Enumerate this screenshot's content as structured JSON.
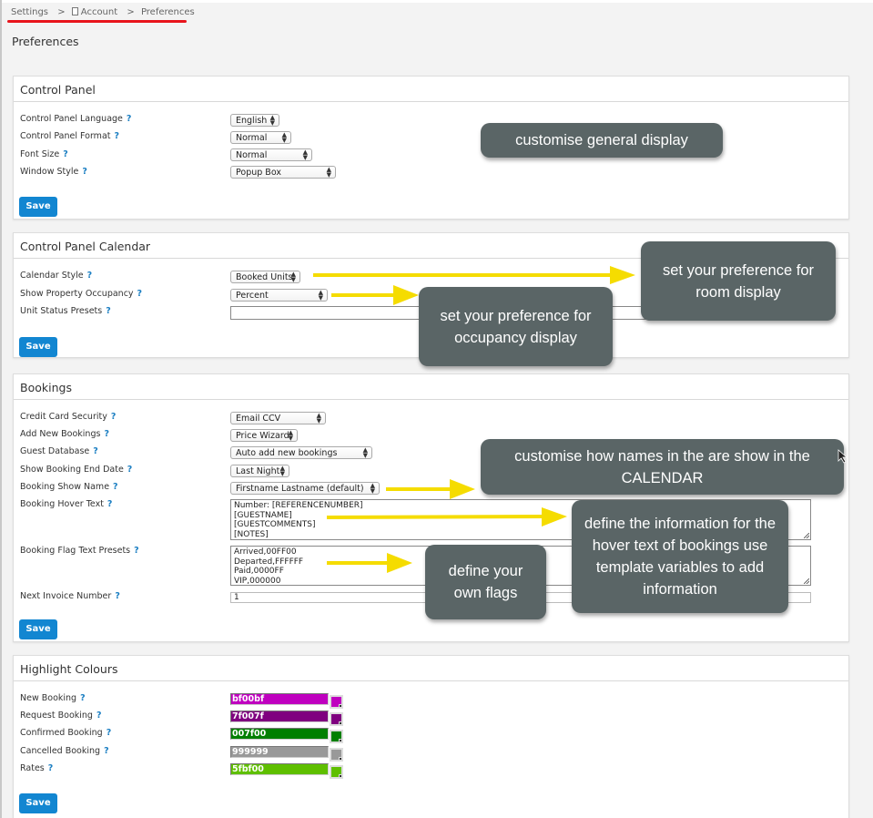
{
  "breadcrumb": {
    "items": [
      "Settings",
      "Account",
      "Preferences"
    ],
    "separator": ">"
  },
  "page_title": "Preferences",
  "help_glyph": "?",
  "save_label": "Save",
  "control_panel": {
    "title": "Control Panel",
    "fields": [
      {
        "label": "Control Panel Language",
        "value": "English"
      },
      {
        "label": "Control Panel Format",
        "value": "Normal"
      },
      {
        "label": "Font Size",
        "value": "Normal"
      },
      {
        "label": "Window Style",
        "value": "Popup Box"
      }
    ]
  },
  "calendar": {
    "title": "Control Panel Calendar",
    "fields": [
      {
        "label": "Calendar Style",
        "value": "Booked Units"
      },
      {
        "label": "Show Property Occupancy",
        "value": "Percent"
      },
      {
        "label": "Unit Status Presets",
        "value": ""
      }
    ]
  },
  "bookings": {
    "title": "Bookings",
    "fields": [
      {
        "label": "Credit Card Security",
        "value": "Email CCV"
      },
      {
        "label": "Add New Bookings",
        "value": "Price Wizard"
      },
      {
        "label": "Guest Database",
        "value": "Auto add new bookings"
      },
      {
        "label": "Show Booking End Date",
        "value": "Last Night"
      },
      {
        "label": "Booking Show Name",
        "value": "Firstname Lastname (default)"
      },
      {
        "label": "Booking Hover Text",
        "value": "Number: [REFERENCENUMBER]\n[GUESTNAME]\n[GUESTCOMMENTS]\n[NOTES]"
      },
      {
        "label": "Booking Flag Text Presets",
        "value": "Arrived,00FF00\nDeparted,FFFFFF\nPaid,0000FF\nVIP,000000"
      },
      {
        "label": "Next Invoice Number",
        "value": "1"
      }
    ]
  },
  "highlight_colours": {
    "title": "Highlight Colours",
    "fields": [
      {
        "label": "New Booking",
        "value": "bf00bf",
        "color": "#bf00bf"
      },
      {
        "label": "Request Booking",
        "value": "7f007f",
        "color": "#7f007f"
      },
      {
        "label": "Confirmed Booking",
        "value": "007f00",
        "color": "#007f00"
      },
      {
        "label": "Cancelled Booking",
        "value": "999999",
        "color": "#999999"
      },
      {
        "label": "Rates",
        "value": "5fbf00",
        "color": "#5fbf00"
      }
    ]
  },
  "annotations": {
    "general_display": "customise general display",
    "room_display": "set your preference for room display",
    "occupancy_display": "set your preference for occupancy display",
    "calendar_names": "customise how names in the  are show in the CALENDAR",
    "hover_text": "define the information for the hover text of bookings use template variables to add information",
    "own_flags": "define your own flags"
  },
  "colors": {
    "accent": "#1286d1",
    "help": "#1a7ec2",
    "callout_bg": "#5a6566",
    "arrow": "#f5dc00",
    "underline": "#e8141c"
  }
}
